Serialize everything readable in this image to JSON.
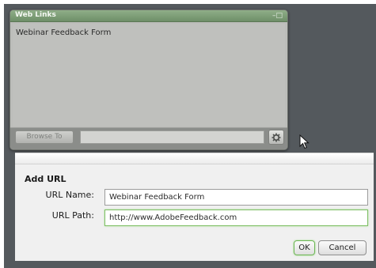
{
  "pod": {
    "title": "Web Links",
    "controls_glyph": "–□",
    "items": [
      "Webinar Feedback Form"
    ],
    "browse_button_label": "Browse To",
    "browse_field_value": "",
    "options_icon": "gear-icon"
  },
  "dialog": {
    "title": "Add URL",
    "name_label": "URL Name:",
    "name_value": "Webinar Feedback Form",
    "path_label": "URL Path:",
    "path_value": "http://www.AdobeFeedback.com",
    "ok_label": "OK",
    "cancel_label": "Cancel"
  },
  "colors": {
    "pod_titlebar": "#7d9d76",
    "focus_accent": "#7fbf66",
    "backdrop": "#54595d"
  }
}
